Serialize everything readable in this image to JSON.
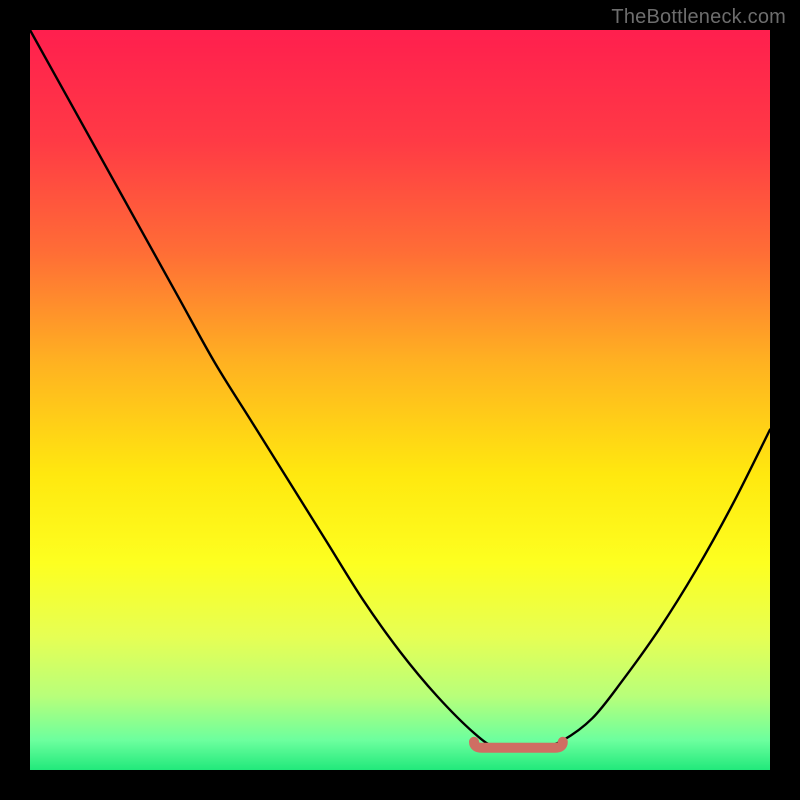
{
  "watermark": "TheBottleneck.com",
  "colors": {
    "black": "#000000",
    "curve_stroke": "#000000",
    "marker": "#cf6e63",
    "gradient_stops": [
      {
        "offset": 0,
        "color": "#ff1f4e"
      },
      {
        "offset": 0.15,
        "color": "#ff3a45"
      },
      {
        "offset": 0.3,
        "color": "#ff6d36"
      },
      {
        "offset": 0.45,
        "color": "#ffb221"
      },
      {
        "offset": 0.6,
        "color": "#ffe80f"
      },
      {
        "offset": 0.72,
        "color": "#fdff20"
      },
      {
        "offset": 0.82,
        "color": "#e6ff54"
      },
      {
        "offset": 0.9,
        "color": "#b8ff7a"
      },
      {
        "offset": 0.96,
        "color": "#6cff9e"
      },
      {
        "offset": 1.0,
        "color": "#21e97b"
      }
    ]
  },
  "chart_data": {
    "type": "line",
    "title": "",
    "xlabel": "",
    "ylabel": "",
    "xlim": [
      0,
      1
    ],
    "ylim": [
      0,
      1
    ],
    "series": [
      {
        "name": "curve",
        "x": [
          0.0,
          0.05,
          0.1,
          0.15,
          0.2,
          0.25,
          0.3,
          0.35,
          0.4,
          0.45,
          0.5,
          0.55,
          0.6,
          0.63,
          0.66,
          0.69,
          0.72,
          0.76,
          0.8,
          0.85,
          0.9,
          0.95,
          1.0
        ],
        "y": [
          1.0,
          0.91,
          0.82,
          0.73,
          0.64,
          0.55,
          0.47,
          0.39,
          0.31,
          0.23,
          0.16,
          0.1,
          0.05,
          0.03,
          0.03,
          0.03,
          0.04,
          0.07,
          0.12,
          0.19,
          0.27,
          0.36,
          0.46
        ]
      }
    ],
    "highlight": {
      "name": "minimum-plateau",
      "x_range": [
        0.6,
        0.72
      ],
      "y": 0.03
    }
  }
}
